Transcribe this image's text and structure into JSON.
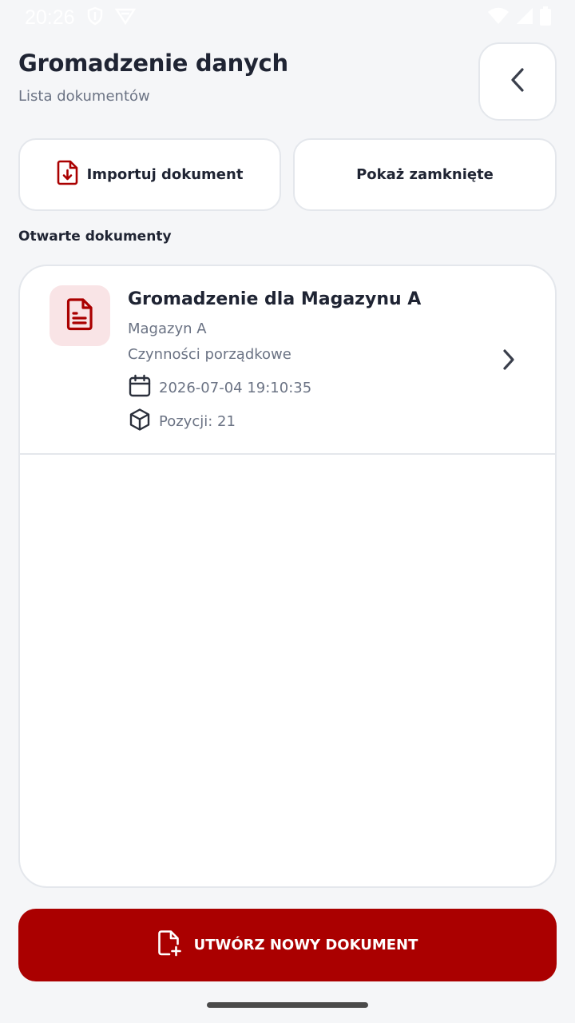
{
  "status_bar": {
    "time": "20:26",
    "icons": [
      "shield-icon",
      "vpn-icon",
      "wifi-icon",
      "cellular-signal-icon",
      "battery-icon"
    ]
  },
  "header": {
    "title": "Gromadzenie danych",
    "subtitle": "Lista dokumentów",
    "back_icon": "chevron-left-icon"
  },
  "actions": {
    "import_label": "Importuj dokument",
    "import_icon": "file-download-icon",
    "show_closed_label": "Pokaż zamknięte"
  },
  "section": {
    "title": "Otwarte dokumenty"
  },
  "documents": [
    {
      "title": "Gromadzenie dla Magazynu A",
      "warehouse": "Magazyn A",
      "activity": "Czynności porządkowe",
      "date": "2026-07-04 19:10:35",
      "items": "Pozycji: 21",
      "icon": "document-icon"
    }
  ],
  "primary_action": {
    "label": "UTWÓRZ NOWY DOKUMENT",
    "icon": "file-plus-icon"
  },
  "colors": {
    "accent": "#aa0000",
    "accent_soft": "#f9e4e6",
    "background": "#f5f6f8",
    "text_primary": "#1f2433",
    "text_secondary": "#6b7384",
    "border": "#e4e7ec"
  }
}
